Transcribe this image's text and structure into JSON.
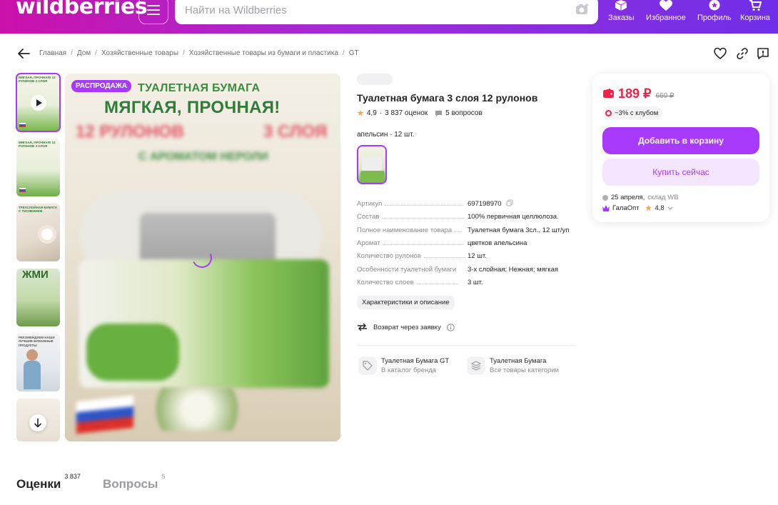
{
  "header": {
    "logo": "wildberries",
    "search_placeholder": "Найти на Wildberries",
    "nav": [
      {
        "label": "Заказы",
        "icon": "box-icon"
      },
      {
        "label": "Избранное",
        "icon": "heart-icon"
      },
      {
        "label": "Профиль",
        "icon": "profile-icon"
      },
      {
        "label": "Корзина",
        "icon": "cart-icon"
      }
    ]
  },
  "breadcrumb": [
    "Главная",
    "Дом",
    "Хозяйственные товары",
    "Хозяйственные товары из бумаги и пластика",
    "GT"
  ],
  "gallery": {
    "sale_badge": "РАСПРОДАЖА",
    "main_title_line1": "ТУАЛЕТНАЯ БУМАГА",
    "main_title_line2": "МЯГКАЯ, ПРОЧНАЯ!",
    "main_title_line3_left": "12 РУЛОНОВ",
    "main_title_line3_right": "3 СЛОЯ",
    "main_title_line4": "С АРОМАТОМ НЕРОЛИ",
    "thumb1_text": "МЯГКАЯ, ПРОЧНАЯ! 12 РУЛОНОВ 3 СЛОЯ",
    "thumb2_text": "МЯГКАЯ, ПРОЧНАЯ! 12 РУЛОНОВ 3 СЛОЯ",
    "thumb3_text": "ТРЕХСЛОЙНАЯ БУМАГА С ТИСНЕНИЕМ",
    "thumb4_text": "ЖМИ",
    "thumb5_text": "РЕКОМЕНДУЕМ НАШИ ЛУЧШИЕ БУМАЖНЫЕ ПРОДУКТЫ"
  },
  "product": {
    "title": "Туалетная бумага 3 слоя 12 рулонов",
    "rating": "4,9",
    "reviews": "3 837 оценок",
    "questions": "5 вопросов",
    "color_line": "апельсин · 12 шт.",
    "specs": [
      {
        "key": "Артикул",
        "value": "697198970"
      },
      {
        "key": "Состав",
        "value": "100% первичная целлюлоза."
      },
      {
        "key": "Полное наименование товара",
        "value": "Туалетная бумага 3сл., 12 шт/уп"
      },
      {
        "key": "Аромат",
        "value": "цветков апельсина"
      },
      {
        "key": "Количество рулонов",
        "value": "12 шт."
      },
      {
        "key": "Особенности туалетной бумаги",
        "value": "3-х слойная; Нежная; мягкая"
      },
      {
        "key": "Количество слоев",
        "value": "3 шт."
      }
    ],
    "desc_button": "Характеристики и описание",
    "returns": "Возврат через заявку",
    "brand_title": "Туалетная Бумага GT",
    "brand_sub": "В каталог бренда",
    "category_title": "Туалетная Бумага",
    "category_sub": "Все товары категории"
  },
  "price_card": {
    "price": "189 ₽",
    "old_price": "660 ₽",
    "club": "−3% с клубом",
    "add_to_cart": "Добавить в корзину",
    "buy_now": "Купить сейчас",
    "delivery_date": "25 апреля,",
    "warehouse": "склад WB",
    "seller": "ГалаОпт",
    "seller_rating": "4,8"
  },
  "tabs": [
    {
      "label": "Оценки",
      "count": "3 837"
    },
    {
      "label": "Вопросы",
      "count": "5"
    }
  ],
  "colors": {
    "accent": "#a73afd",
    "price": "#f0224a",
    "header_start": "#cb11ab",
    "header_end": "#6f2ee8"
  }
}
